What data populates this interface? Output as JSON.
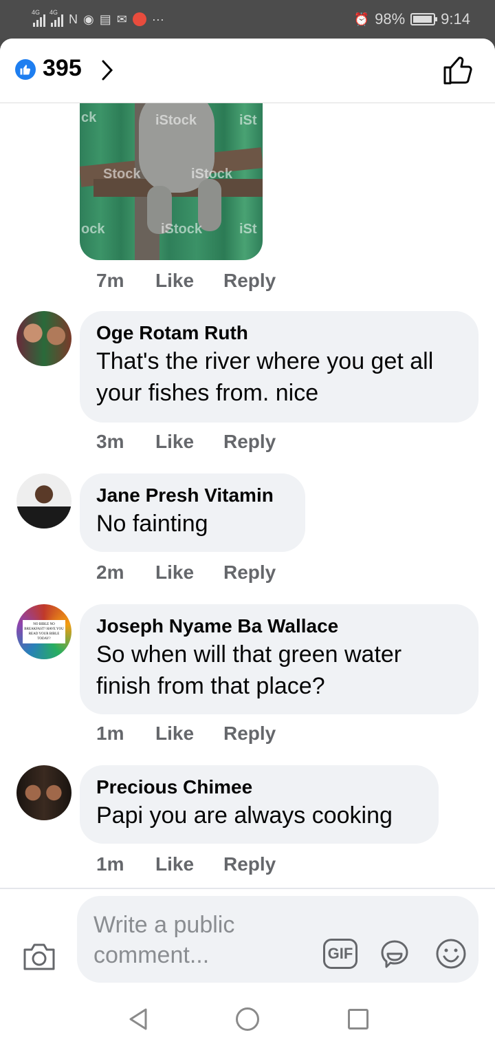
{
  "status_bar": {
    "network_1": "4G",
    "network_2": "4G",
    "more": "···",
    "battery": "98%",
    "time": "9:14"
  },
  "header": {
    "reaction_count": "395",
    "icons": [
      "like-reaction-icon",
      "chevron-right-icon",
      "thumbs-up-icon"
    ],
    "accent_color": "#1e7ef0"
  },
  "image": {
    "watermarks": [
      "ck",
      "iStock",
      "iSt",
      "Stock",
      "iStock",
      "ock",
      "iStock",
      "iSt"
    ]
  },
  "comments": [
    {
      "time": "7m",
      "like": "Like",
      "reply": "Reply"
    },
    {
      "name": "Oge Rotam Ruth",
      "text": "That's the river where you get all your fishes from. nice",
      "time": "3m",
      "like": "Like",
      "reply": "Reply"
    },
    {
      "name": "Jane Presh Vitamin",
      "text": "No fainting",
      "time": "2m",
      "like": "Like",
      "reply": "Reply"
    },
    {
      "name": "Joseph Nyame Ba Wallace",
      "text": "So when will that green water finish from that place?",
      "time": "1m",
      "like": "Like",
      "reply": "Reply",
      "avatar_text": "NO BIBLE NO BREAKFAST? HAVE YOU READ YOUR BIBLE TODAY?"
    },
    {
      "name": "Precious Chimee",
      "text": "Papi you are always cooking",
      "time": "1m",
      "like": "Like",
      "reply": "Reply"
    }
  ],
  "composer": {
    "placeholder": "Write a public comment...",
    "gif_label": "GIF",
    "icons": [
      "camera-icon",
      "gif-icon",
      "sticker-icon",
      "emoji-icon"
    ]
  },
  "nav": {
    "icons": [
      "back-icon",
      "home-icon",
      "recents-icon"
    ]
  }
}
